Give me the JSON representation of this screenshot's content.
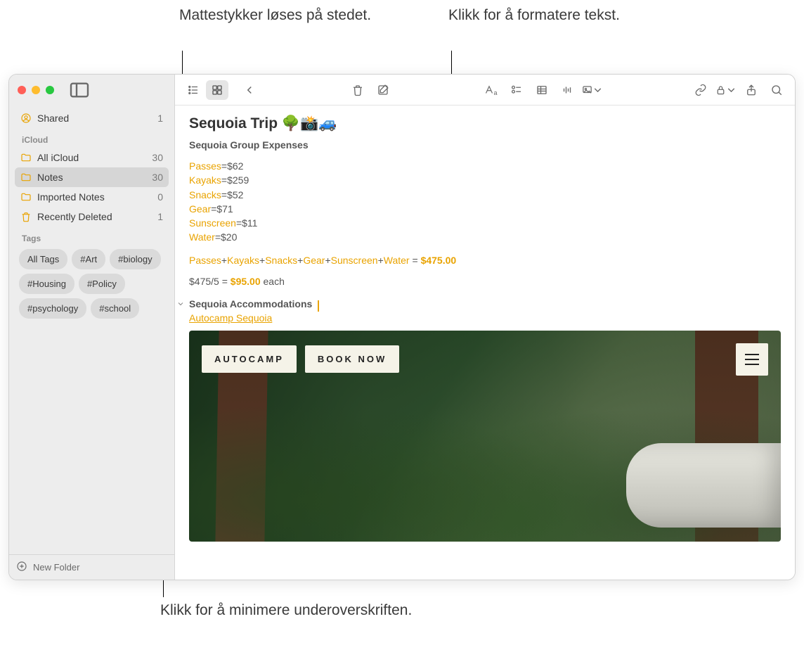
{
  "callouts": {
    "math": "Mattestykker løses på stedet.",
    "format": "Klikk for å formatere tekst.",
    "collapse": "Klikk for å minimere underoverskriften."
  },
  "sidebar": {
    "shared": {
      "label": "Shared",
      "count": "1"
    },
    "section_icloud": "iCloud",
    "folders": [
      {
        "label": "All iCloud",
        "count": "30"
      },
      {
        "label": "Notes",
        "count": "30",
        "selected": true
      },
      {
        "label": "Imported Notes",
        "count": "0"
      },
      {
        "label": "Recently Deleted",
        "count": "1",
        "trash": true
      }
    ],
    "section_tags": "Tags",
    "tags": [
      "All Tags",
      "#Art",
      "#biology",
      "#Housing",
      "#Policy",
      "#psychology",
      "#school"
    ],
    "new_folder": "New Folder"
  },
  "note": {
    "title": "Sequoia Trip 🌳📸🚙",
    "subtitle": "Sequoia Group Expenses",
    "expenses": [
      {
        "name": "Passes",
        "value": "=$62"
      },
      {
        "name": "Kayaks",
        "value": "=$259"
      },
      {
        "name": "Snacks",
        "value": "=$52"
      },
      {
        "name": "Gear",
        "value": "=$71"
      },
      {
        "name": "Sunscreen",
        "value": "=$11"
      },
      {
        "name": "Water",
        "value": "=$20"
      }
    ],
    "formula_vars": [
      "Passes",
      "Kayaks",
      "Snacks",
      "Gear",
      "Sunscreen",
      "Water"
    ],
    "formula_eq": " = ",
    "formula_result": "$475.00",
    "per_person_prefix": "$475/5 = ",
    "per_person_result": "$95.00",
    "per_person_suffix": "  each",
    "section2": "Sequoia Accommodations",
    "link": "Autocamp Sequoia",
    "attachment": {
      "brand": "AUTOCAMP",
      "cta": "BOOK NOW"
    }
  }
}
